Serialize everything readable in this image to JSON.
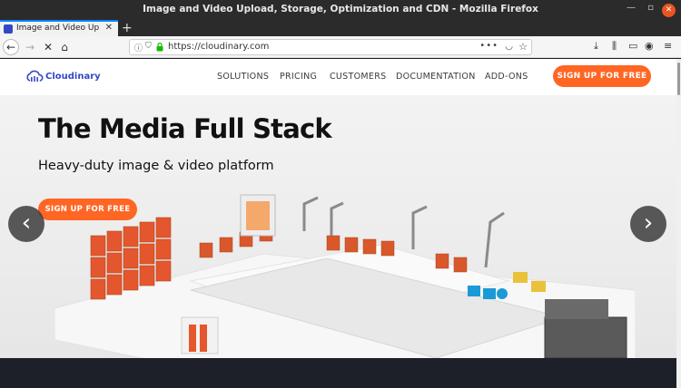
{
  "window": {
    "title": "Image and Video Upload, Storage, Optimization and CDN - Mozilla Firefox"
  },
  "tabs": [
    {
      "label": "Image and Video Upload"
    }
  ],
  "navbar": {
    "url": "https://cloudinary.com"
  },
  "site": {
    "logo_text": "Cloudinary",
    "menu": [
      "SOLUTIONS",
      "PRICING",
      "CUSTOMERS",
      "DOCUMENTATION",
      "ADD-ONS"
    ],
    "signup_label": "SIGN UP FOR FREE"
  },
  "hero": {
    "title": "The Media Full Stack",
    "subtitle": "Heavy-duty image & video platform",
    "cta_label": "SIGN UP FOR FREE",
    "prev_arrow": "‹",
    "next_arrow": "›"
  },
  "colors": {
    "accent": "#ff6624",
    "brand": "#3448c5",
    "dark_band": "#1e2029"
  }
}
